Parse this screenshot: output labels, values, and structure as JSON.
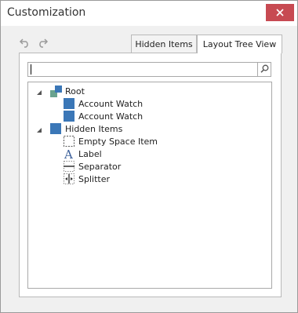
{
  "window": {
    "title": "Customization"
  },
  "toolbar": {
    "undo_icon": "undo-icon",
    "redo_icon": "redo-icon"
  },
  "tabs": [
    {
      "label": "Hidden Items",
      "active": false
    },
    {
      "label": "Layout Tree View",
      "active": true
    }
  ],
  "search": {
    "value": "",
    "placeholder": ""
  },
  "tree": {
    "root": {
      "label": "Root",
      "expanded": true,
      "children": [
        {
          "label": "Account Watch",
          "icon": "layout-item-icon"
        },
        {
          "label": "Account Watch",
          "icon": "layout-item-icon"
        }
      ]
    },
    "hidden": {
      "label": "Hidden Items",
      "expanded": true,
      "children": [
        {
          "label": "Empty Space Item",
          "icon": "empty-space-icon"
        },
        {
          "label": "Label",
          "icon": "label-icon"
        },
        {
          "label": "Separator",
          "icon": "separator-icon"
        },
        {
          "label": "Splitter",
          "icon": "splitter-icon"
        }
      ]
    }
  },
  "colors": {
    "close_button": "#c74a52",
    "item_icon": "#3b77b7",
    "root_icon_secondary": "#6aa38f"
  }
}
